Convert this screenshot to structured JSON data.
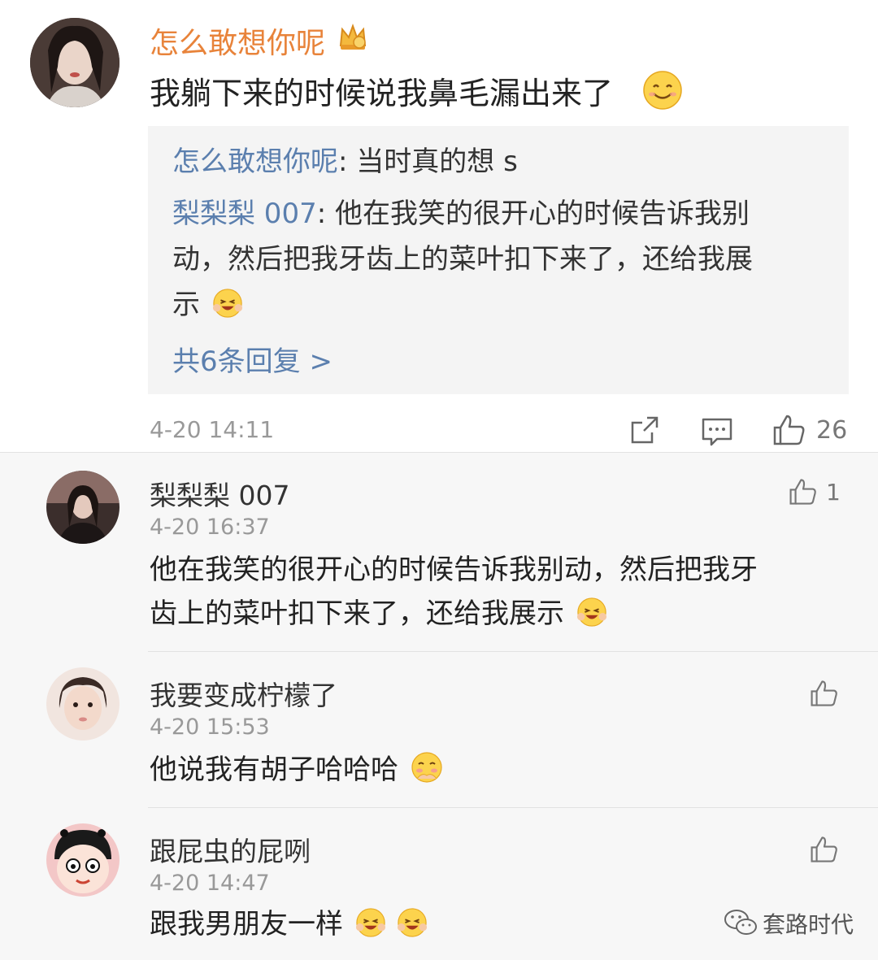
{
  "main": {
    "author": "怎么敢想你呢",
    "text": "我躺下来的时候说我鼻毛漏出来了",
    "replies": [
      {
        "author": "怎么敢想你呢",
        "text": ": 当时真的想 s"
      },
      {
        "author": "梨梨梨 007",
        "text": ": 他在我笑的很开心的时候告诉我别"
      }
    ],
    "reply_cont1": "动，然后把我牙齿上的菜叶扣下来了，还给我展",
    "reply_cont2": "示",
    "more": "共6条回复 >",
    "time": "4-20 14:11",
    "likes": "26"
  },
  "comments": [
    {
      "author": "梨梨梨 007",
      "time": "4-20 16:37",
      "line1": "他在我笑的很开心的时候告诉我别动，然后把我牙",
      "line2": "齿上的菜叶扣下来了，还给我展示",
      "likes": "1"
    },
    {
      "author": "我要变成柠檬了",
      "time": "4-20 15:53",
      "line1": "他说我有胡子哈哈哈"
    },
    {
      "author": "跟屁虫的屁咧",
      "time": "4-20 14:47",
      "line1": "跟我男朋友一样"
    }
  ],
  "watermark": "套路时代",
  "colors": {
    "accent_orange": "#e8833a",
    "link_blue": "#5b7fae"
  }
}
